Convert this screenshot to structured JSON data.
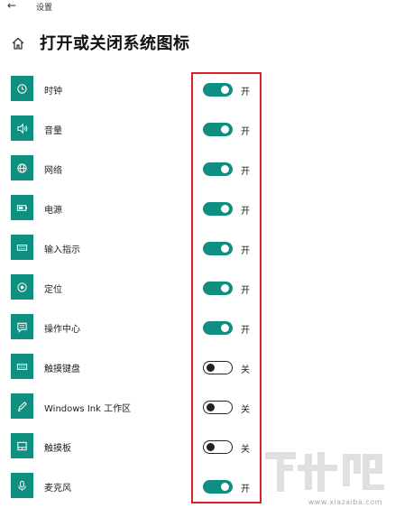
{
  "window": {
    "title": "设置"
  },
  "page": {
    "title": "打开或关闭系统图标"
  },
  "items": [
    {
      "label": "时钟",
      "on": true,
      "state_text": "开",
      "icon": "clock-icon"
    },
    {
      "label": "音量",
      "on": true,
      "state_text": "开",
      "icon": "volume-icon"
    },
    {
      "label": "网络",
      "on": true,
      "state_text": "开",
      "icon": "globe-icon"
    },
    {
      "label": "电源",
      "on": true,
      "state_text": "开",
      "icon": "battery-icon"
    },
    {
      "label": "输入指示",
      "on": true,
      "state_text": "开",
      "icon": "keyboard-icon"
    },
    {
      "label": "定位",
      "on": true,
      "state_text": "开",
      "icon": "location-icon"
    },
    {
      "label": "操作中心",
      "on": true,
      "state_text": "开",
      "icon": "action-center-icon"
    },
    {
      "label": "触摸键盘",
      "on": false,
      "state_text": "关",
      "icon": "touch-keyboard-icon"
    },
    {
      "label": "Windows Ink 工作区",
      "on": false,
      "state_text": "关",
      "icon": "pen-icon"
    },
    {
      "label": "触摸板",
      "on": false,
      "state_text": "关",
      "icon": "touchpad-icon"
    },
    {
      "label": "麦克风",
      "on": true,
      "state_text": "开",
      "icon": "microphone-icon"
    }
  ],
  "watermark": {
    "text": "下载吧",
    "url": "www.xiazaiba.com"
  },
  "colors": {
    "accent": "#0f8f7f",
    "highlight": "#d8222a"
  }
}
